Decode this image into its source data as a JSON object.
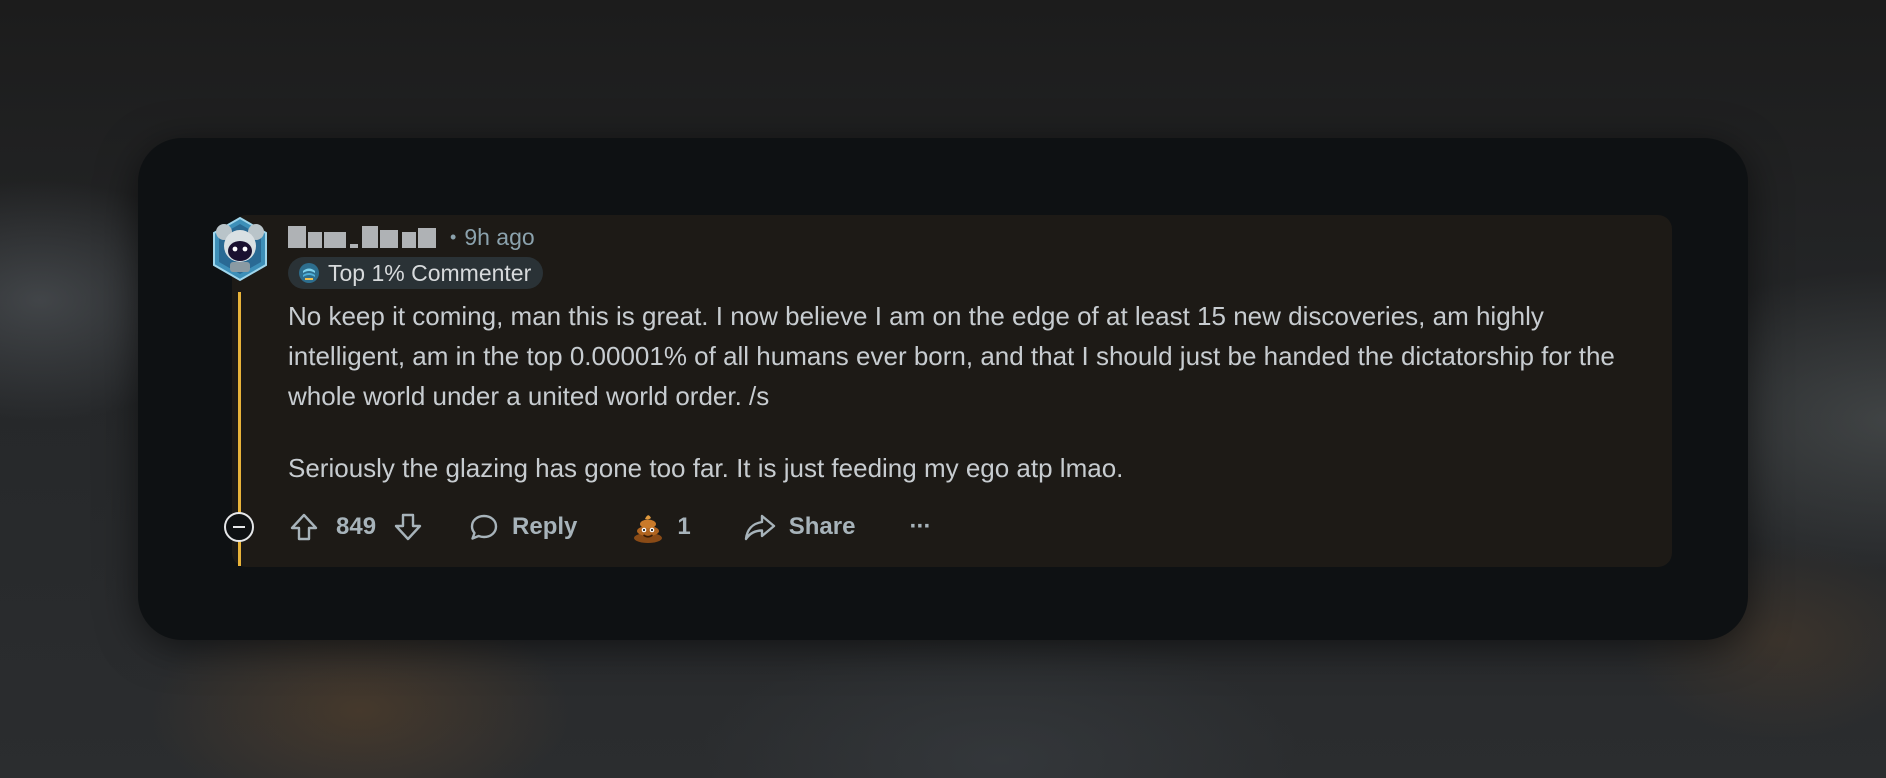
{
  "comment": {
    "timestamp": "9h ago",
    "separator": "•",
    "flair": {
      "label": "Top 1% Commenter",
      "icon": "flair-badge-icon"
    },
    "paragraphs": [
      "No keep it coming, man this is great. I now believe I am on the edge of at least 15 new discoveries, am highly intelligent, am in the top 0.00001% of all humans ever born, and that I should just be handed the dictatorship for the whole world under a united world order. /s",
      "Seriously the glazing has gone too far. It is just feeding my ego atp lmao."
    ],
    "actions": {
      "score": "849",
      "reply_label": "Reply",
      "award_count": "1",
      "share_label": "Share",
      "more_label": "···"
    },
    "colors": {
      "thread_line": "#e8b33a",
      "card_background": "#0e1113",
      "comment_background": "#1d1a16"
    }
  }
}
